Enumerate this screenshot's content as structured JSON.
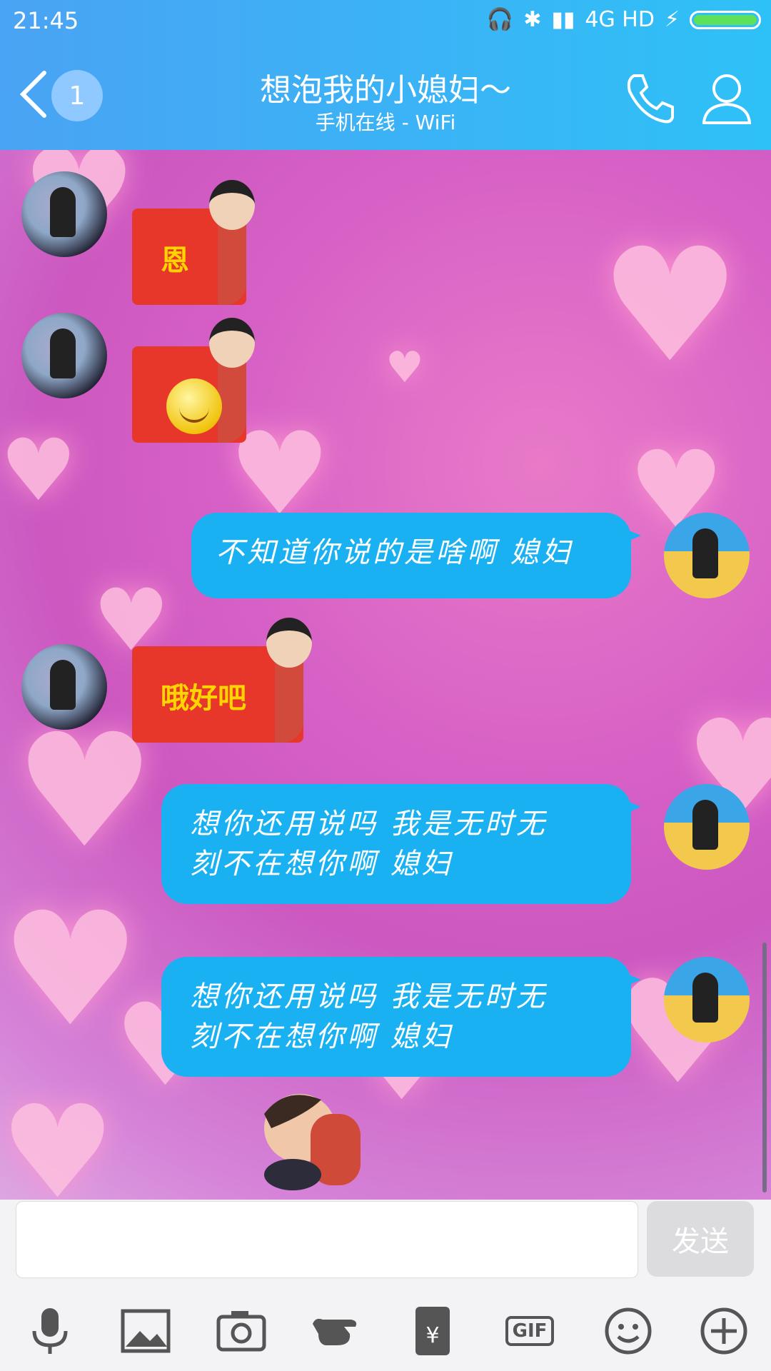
{
  "status": {
    "time": "21:45",
    "network": "4G HD"
  },
  "header": {
    "back_badge": "1",
    "title": "想泡我的小媳妇～",
    "subtitle": "手机在线 - WiFi"
  },
  "messages": [
    {
      "from": "her",
      "type": "red-envelope",
      "text": "恩"
    },
    {
      "from": "her",
      "type": "red-envelope",
      "emoji": "smile"
    },
    {
      "from": "me",
      "type": "text",
      "text": "不知道你说的是啥啊 媳妇"
    },
    {
      "from": "her",
      "type": "red-envelope",
      "text": "哦好吧"
    },
    {
      "from": "me",
      "type": "text",
      "line1": "想你还用说吗  我是无时无",
      "line2": "刻不在想你啊 媳妇"
    },
    {
      "from": "me",
      "type": "text",
      "line1": "想你还用说吗  我是无时无",
      "line2": "刻不在想你啊 媳妇"
    }
  ],
  "input": {
    "placeholder": "",
    "send_label": "发送"
  },
  "toolbar": {
    "gif_label": "GIF"
  },
  "colors": {
    "header": "#2ec1f7",
    "bubble": "#1ab1f2",
    "envelope": "#e7372a"
  }
}
